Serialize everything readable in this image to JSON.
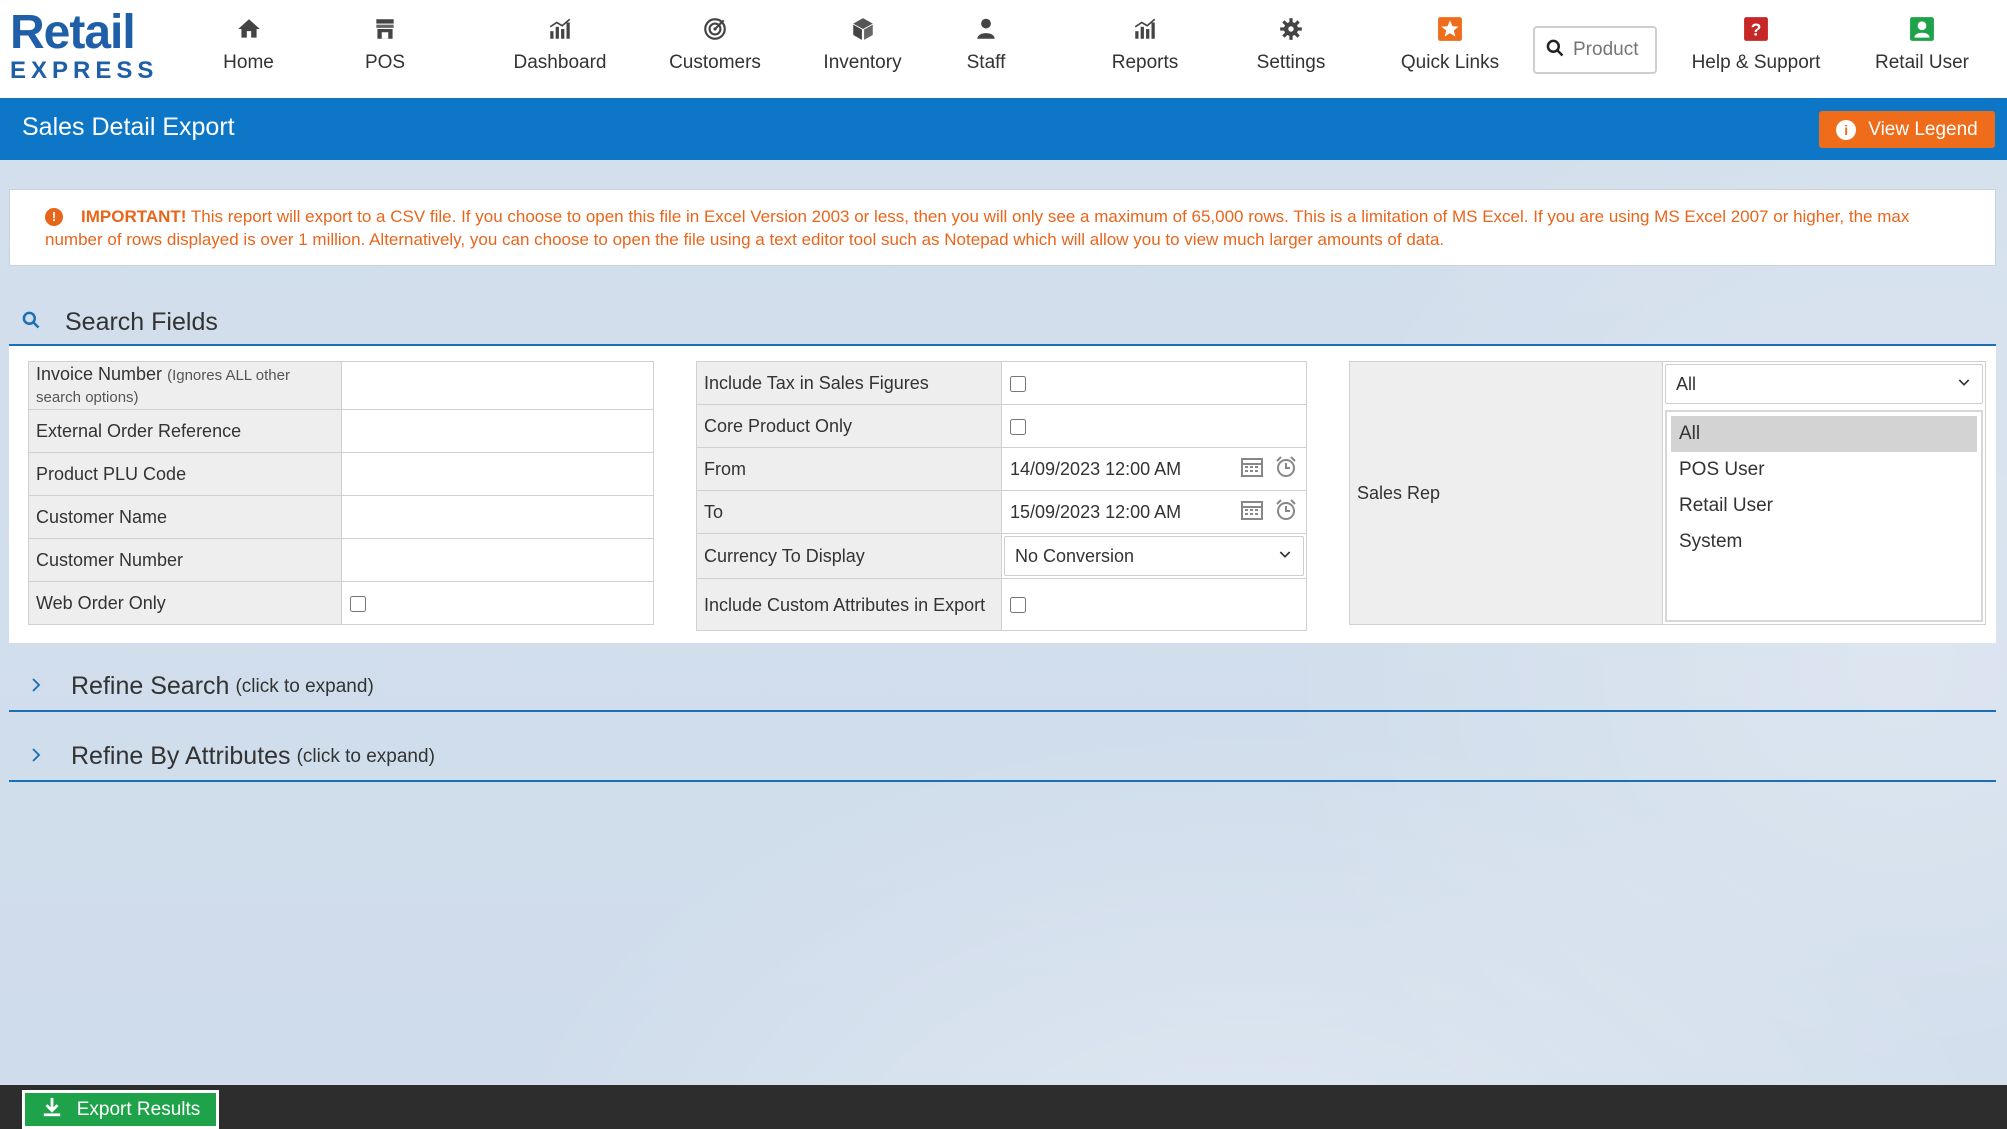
{
  "brand": {
    "line1": "Retail",
    "line2": "EXPRESS"
  },
  "nav": {
    "items": [
      {
        "label": "Home",
        "icon": "home-icon"
      },
      {
        "label": "POS",
        "icon": "store-icon"
      },
      {
        "label": "Dashboard",
        "icon": "bar-chart-icon"
      },
      {
        "label": "Customers",
        "icon": "target-icon"
      },
      {
        "label": "Inventory",
        "icon": "box-icon"
      },
      {
        "label": "Staff",
        "icon": "user-icon"
      },
      {
        "label": "Reports",
        "icon": "bar-chart-icon"
      },
      {
        "label": "Settings",
        "icon": "gear-icon"
      },
      {
        "label": "Quick Links",
        "icon": "star-icon"
      },
      {
        "label": "Help & Support",
        "icon": "help-icon"
      },
      {
        "label": "Retail User",
        "icon": "user-badge-icon"
      }
    ],
    "search_placeholder": "Product"
  },
  "header": {
    "title": "Sales Detail Export",
    "legend_button": "View Legend"
  },
  "notice": {
    "important": "IMPORTANT!",
    "text": " This report will export to a CSV file. If you choose to open this file in Excel Version 2003 or less, then you will only see a maximum of 65,000 rows. This is a limitation of MS Excel. If you are using MS Excel 2007 or higher, the max number of rows displayed is over 1 million. Alternatively, you can choose to open the file using a text editor tool such as Notepad which will allow you to view much larger amounts of data."
  },
  "search_fields": {
    "heading": "Search Fields",
    "left": {
      "invoice_number": "Invoice Number",
      "invoice_note": "(Ignores ALL other search options)",
      "external_order_reference": "External Order Reference",
      "product_plu_code": "Product PLU Code",
      "customer_name": "Customer Name",
      "customer_number": "Customer Number",
      "web_order_only": "Web Order Only"
    },
    "middle": {
      "include_tax": "Include Tax in Sales Figures",
      "core_product_only": "Core Product Only",
      "from_label": "From",
      "from_value": "14/09/2023 12:00 AM",
      "to_label": "To",
      "to_value": "15/09/2023 12:00 AM",
      "currency_label": "Currency To Display",
      "currency_value": "No Conversion",
      "include_custom_attributes": "Include Custom Attributes in Export"
    },
    "right": {
      "sales_rep_label": "Sales Rep",
      "sales_rep_selected": "All",
      "sales_rep_options": [
        "All",
        "POS User",
        "Retail User",
        "System"
      ]
    }
  },
  "refine_search": {
    "title": "Refine Search",
    "hint": "(click to expand)"
  },
  "refine_attributes": {
    "title": "Refine By Attributes",
    "hint": "(click to expand)"
  },
  "footer": {
    "export_button": "Export Results"
  },
  "colors": {
    "primary": "#0d76c6",
    "accent": "#ef6c1b",
    "success": "#1fa34a",
    "warning_text": "#e8651c"
  }
}
